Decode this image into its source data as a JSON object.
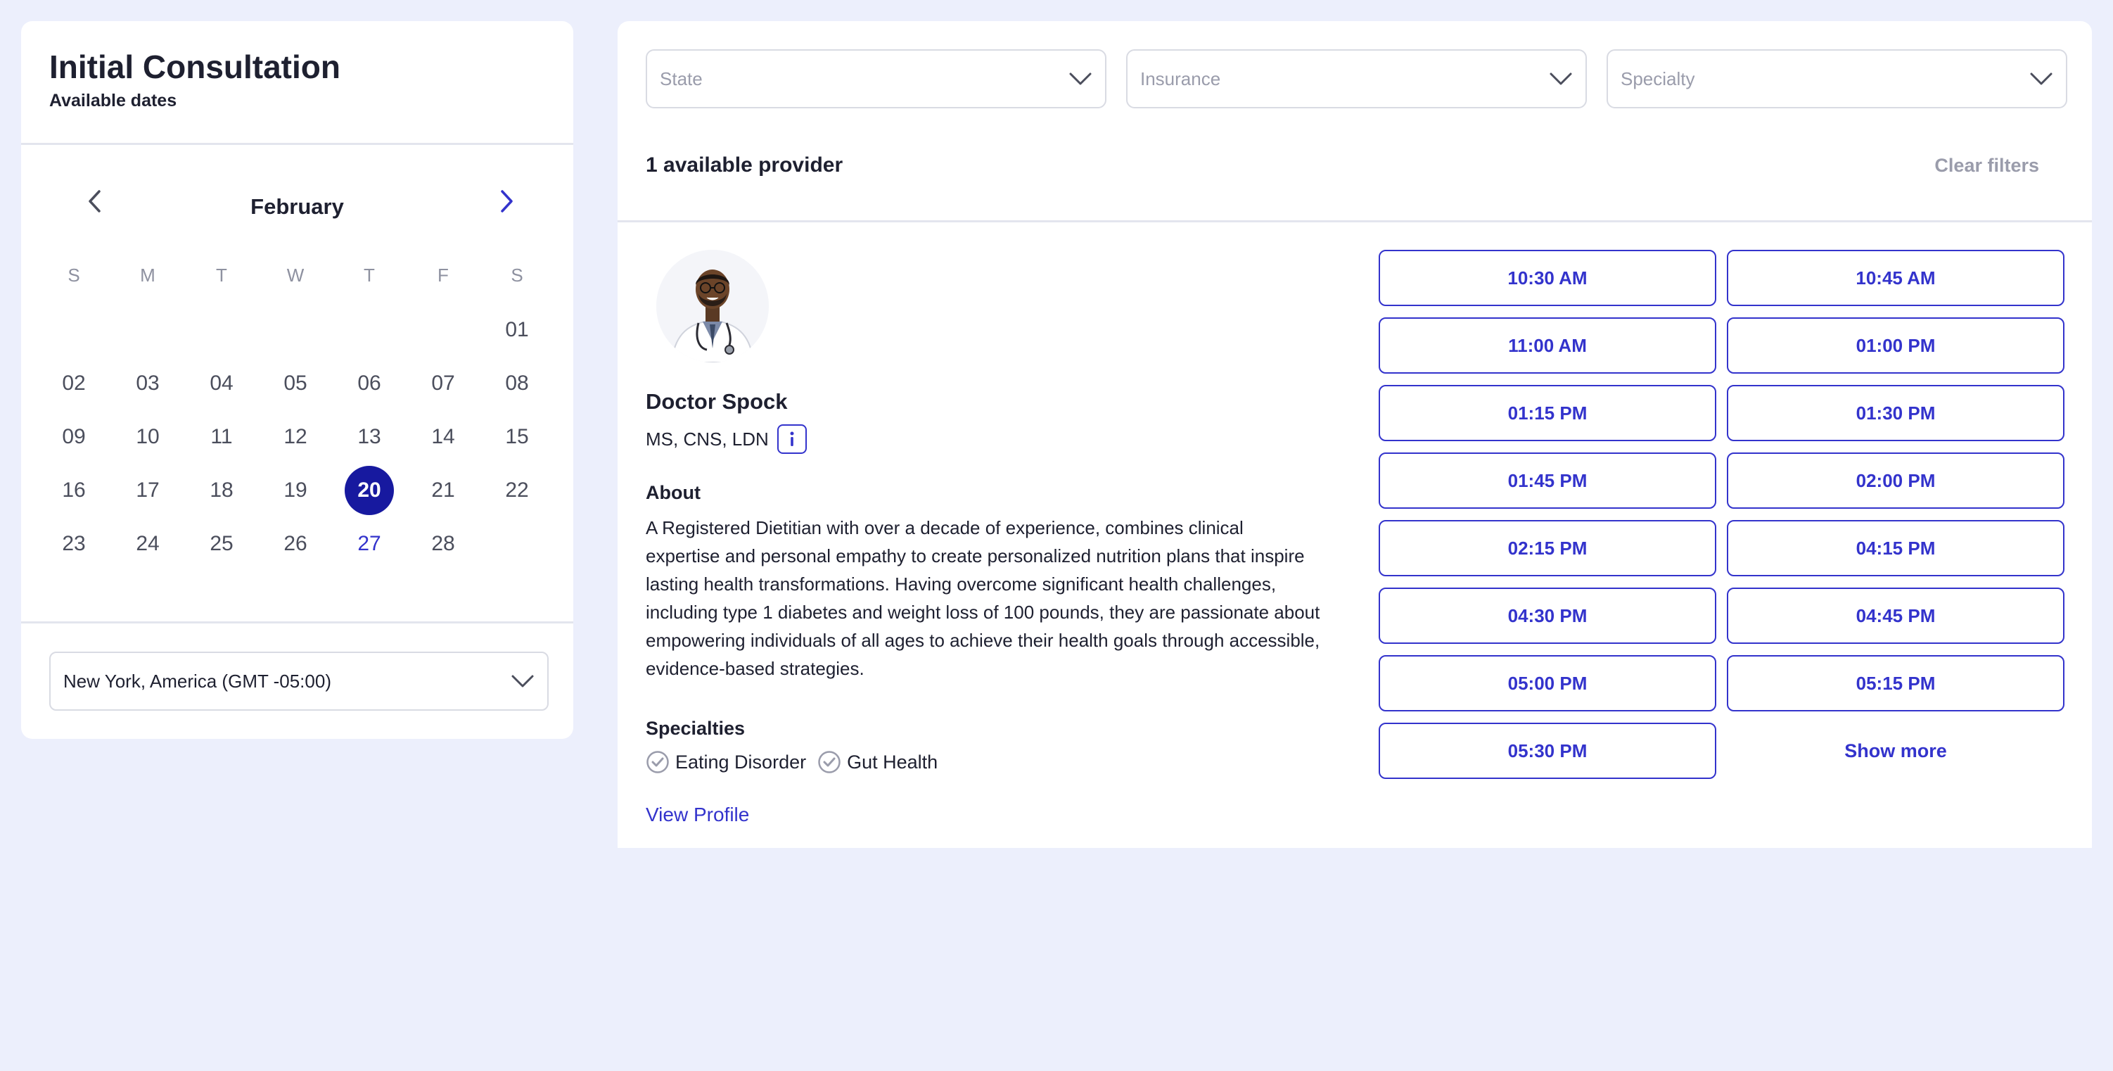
{
  "booking": {
    "title": "Initial Consultation",
    "subtitle": "Available dates"
  },
  "calendar": {
    "month": "February",
    "weekdays": [
      "S",
      "M",
      "T",
      "W",
      "T",
      "F",
      "S"
    ],
    "weeks": [
      [
        "",
        "",
        "",
        "",
        "",
        "",
        "01"
      ],
      [
        "02",
        "03",
        "04",
        "05",
        "06",
        "07",
        "08"
      ],
      [
        "09",
        "10",
        "11",
        "12",
        "13",
        "14",
        "15"
      ],
      [
        "16",
        "17",
        "18",
        "19",
        "20",
        "21",
        "22"
      ],
      [
        "23",
        "24",
        "25",
        "26",
        "27",
        "28",
        ""
      ]
    ],
    "selected_day": "20",
    "highlighted_day": "27",
    "prev_icon": "chevron-left-icon",
    "next_icon": "chevron-right-icon"
  },
  "timezone": {
    "value": "New York, America (GMT -05:00)"
  },
  "filters": {
    "state_placeholder": "State",
    "insurance_placeholder": "Insurance",
    "specialty_placeholder": "Specialty"
  },
  "results": {
    "count_label": "1 available provider",
    "clear_label": "Clear filters"
  },
  "provider": {
    "name": "Doctor Spock",
    "credentials": "MS, CNS, LDN",
    "info_icon_label": "i",
    "about_label": "About",
    "about_text": "A Registered Dietitian with over a decade of experience, combines clinical expertise and personal empathy to create personalized nutrition plans that inspire lasting health transformations. Having overcome significant health challenges, including type 1 diabetes and weight loss of 100 pounds, they are passionate about empowering individuals of all ages to achieve their health goals through accessible, evidence-based strategies.",
    "specialties_label": "Specialties",
    "specialties": [
      "Eating Disorder",
      "Gut Health"
    ],
    "view_profile_label": "View Profile"
  },
  "time_slots": [
    "10:30 AM",
    "10:45 AM",
    "11:00 AM",
    "01:00 PM",
    "01:15 PM",
    "01:30 PM",
    "01:45 PM",
    "02:00 PM",
    "02:15 PM",
    "04:15 PM",
    "04:30 PM",
    "04:45 PM",
    "05:00 PM",
    "05:15 PM",
    "05:30 PM"
  ],
  "show_more_label": "Show more",
  "colors": {
    "background": "#eceffc",
    "accent": "#3333cc",
    "selected_day": "#17199f",
    "muted": "#9a9cab"
  }
}
